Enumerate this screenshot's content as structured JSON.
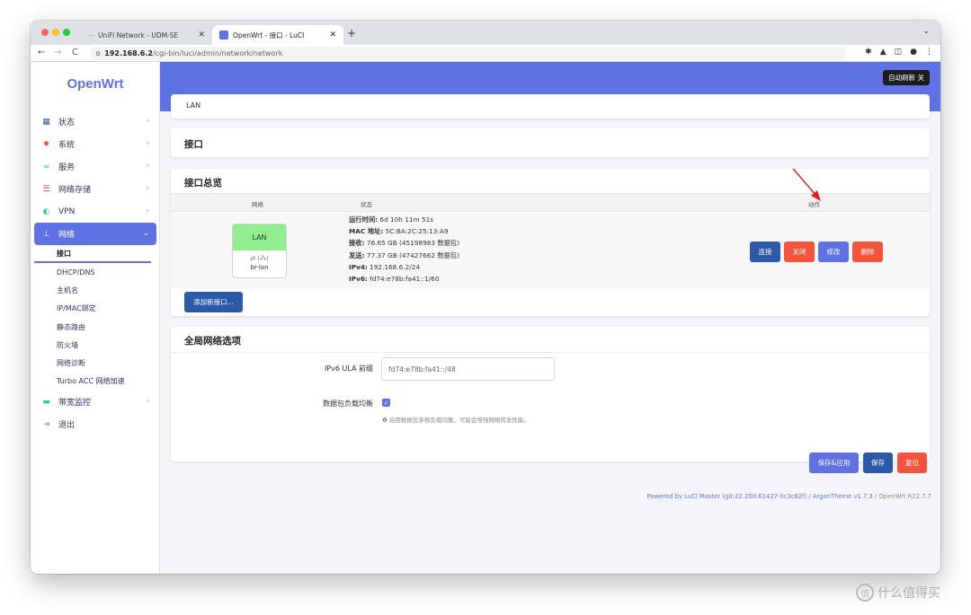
{
  "browser": {
    "tabs": [
      {
        "title": "UniFi Network - UDM-SE"
      },
      {
        "title": "OpenWrt - 接口 - LuCI"
      }
    ],
    "url_host": "192.168.6.2",
    "url_path": "/cgi-bin/luci/admin/network/network"
  },
  "sidebar": {
    "brand": "OpenWrt",
    "items_top": [
      {
        "label": "状态"
      },
      {
        "label": "系统"
      },
      {
        "label": "服务"
      },
      {
        "label": "网络存储"
      },
      {
        "label": "VPN"
      }
    ],
    "network": {
      "label": "网络"
    },
    "network_sub": [
      "接口",
      "DHCP/DNS",
      "主机名",
      "IP/MAC绑定",
      "静态路由",
      "防火墙",
      "网络诊断",
      "Turbo ACC 网络加速"
    ],
    "items_bottom": [
      {
        "label": "带宽监控"
      },
      {
        "label": "退出"
      }
    ]
  },
  "header": {
    "auto_refresh": "自动刷新 关",
    "tab_label": "LAN"
  },
  "page_title": "接口",
  "overview": {
    "title": "接口总览",
    "col_network": "网络",
    "col_status": "状态",
    "col_action": "动作",
    "interface": {
      "name": "LAN",
      "device": "br-lan",
      "status_lines": [
        {
          "label": "运行时间:",
          "value": " 6d 10h 11m 51s"
        },
        {
          "label": "MAC 地址:",
          "value": " 5C:BA:2C:25:13:A9"
        },
        {
          "label": "接收:",
          "value": " 76.65 GB (45198983 数据包)"
        },
        {
          "label": "发送:",
          "value": " 77.37 GB (47427662 数据包)"
        },
        {
          "label": "IPv4:",
          "value": " 192.168.6.2/24"
        },
        {
          "label": "IPv6:",
          "value": " fd74:e78b:fa41::1/60"
        }
      ]
    },
    "buttons": {
      "connect": "连接",
      "stop": "关闭",
      "edit": "修改",
      "delete": "删除"
    },
    "add_button": "添加新接口..."
  },
  "global": {
    "title": "全局网络选项",
    "ula_label": "IPv6 ULA 前缀",
    "ula_value": "fd74:e78b:fa41::/48",
    "packet_steering_label": "数据包负载均衡",
    "packet_steering_checked": true,
    "packet_steering_hint": "启用数据包多核负载均衡。可能会增强网络转发性能。"
  },
  "actions": {
    "save_apply": "保存&应用",
    "save": "保存",
    "reset": "复位"
  },
  "footer": {
    "link": "Powered by LuCI Master (git-22.200.61437-0c3c82f) / ArgonTheme v1.7.3",
    "version": " / OpenWrt R22.7.7"
  },
  "watermark": "什么值得买",
  "colors": {
    "accent": "#5e72e4",
    "blue_btn": "#2d5aa8",
    "red_btn": "#f2553b",
    "lan_green": "#90ee90"
  }
}
